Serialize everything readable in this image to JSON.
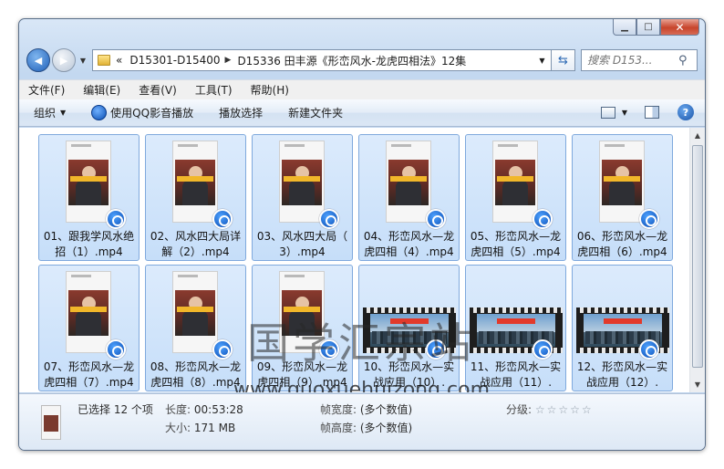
{
  "window": {
    "minimize_label": "▁",
    "maximize_label": "□",
    "close_label": "✕"
  },
  "address": {
    "back_glyph": "◀",
    "forward_glyph": "▶",
    "overflow": "«",
    "crumbs": [
      "D15301-D15400",
      "D15336 田丰源《形峦风水-龙虎四相法》12集"
    ],
    "search_placeholder": "搜索 D153..."
  },
  "menu": [
    "文件(F)",
    "编辑(E)",
    "查看(V)",
    "工具(T)",
    "帮助(H)"
  ],
  "toolbar": {
    "organize": "组织",
    "play_qq": "使用QQ影音播放",
    "play_select": "播放选择",
    "new_folder": "新建文件夹"
  },
  "files": [
    {
      "line1": "01、跟我学风水绝",
      "line2": "招（1）.mp4",
      "thumb": "portrait"
    },
    {
      "line1": "02、风水四大局详",
      "line2": "解（2）.mp4",
      "thumb": "portrait"
    },
    {
      "line1": "03、风水四大局（",
      "line2": "3）.mp4",
      "thumb": "portrait"
    },
    {
      "line1": "04、形峦风水—龙",
      "line2": "虎四相（4）.mp4",
      "thumb": "portrait"
    },
    {
      "line1": "05、形峦风水—龙",
      "line2": "虎四相（5）.mp4",
      "thumb": "portrait"
    },
    {
      "line1": "06、形峦风水—龙",
      "line2": "虎四相（6）.mp4",
      "thumb": "portrait"
    },
    {
      "line1": "07、形峦风水—龙",
      "line2": "虎四相（7）.mp4",
      "thumb": "portrait"
    },
    {
      "line1": "08、形峦风水—龙",
      "line2": "虎四相（8）.mp4",
      "thumb": "portrait"
    },
    {
      "line1": "09、形峦风水—龙",
      "line2": "虎四相（9）.mp4",
      "thumb": "portrait"
    },
    {
      "line1": "10、形峦风水—实",
      "line2": "战应用（10）.",
      "thumb": "landscape"
    },
    {
      "line1": "11、形峦风水—实",
      "line2": "战应用（11）.",
      "thumb": "landscape"
    },
    {
      "line1": "12、形峦风水—实",
      "line2": "战应用（12）.",
      "thumb": "landscape"
    }
  ],
  "watermark": {
    "title": "国学汇宗站",
    "url": "www.guoxuehuizong.com"
  },
  "details": {
    "selected": "已选择 12 个项",
    "length_key": "长度:",
    "length_val": "00:53:28",
    "size_key": "大小:",
    "size_val": "171 MB",
    "frame_width_key": "帧宽度:",
    "frame_width_val": "(多个数值)",
    "frame_height_key": "帧高度:",
    "frame_height_val": "(多个数值)",
    "rating_key": "分级:",
    "rating_stars": "☆☆☆☆☆"
  }
}
